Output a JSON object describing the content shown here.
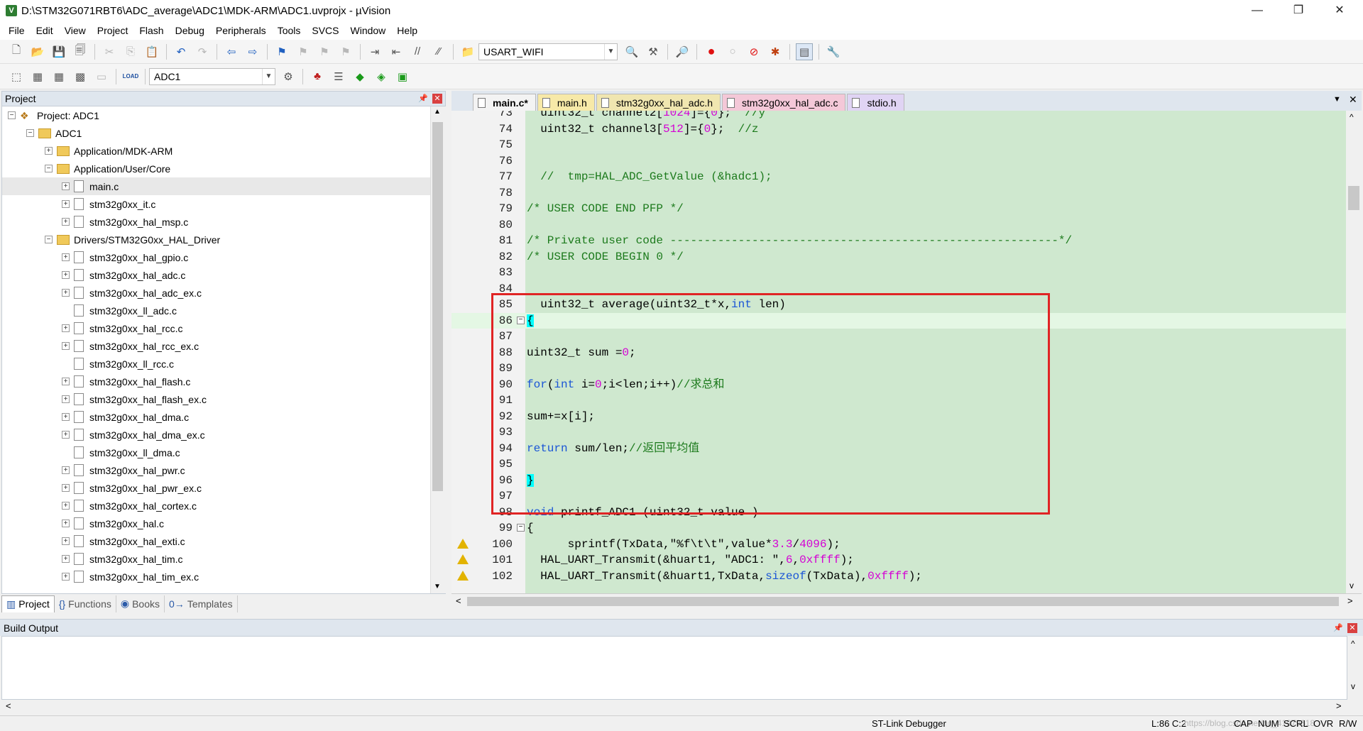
{
  "window": {
    "title": "D:\\STM32G071RBT6\\ADC_average\\ADC1\\MDK-ARM\\ADC1.uvprojx - µVision",
    "minimize": "—",
    "restore": "❐",
    "close": "✕"
  },
  "menu": [
    "File",
    "Edit",
    "View",
    "Project",
    "Flash",
    "Debug",
    "Peripherals",
    "Tools",
    "SVCS",
    "Window",
    "Help"
  ],
  "toolbar": {
    "target_combo": "USART_WIFI",
    "project_combo": "ADC1",
    "load_label": "LOAD"
  },
  "project_panel": {
    "title": "Project",
    "root": "Project: ADC1",
    "target": "ADC1",
    "groups": [
      {
        "name": "Application/MDK-ARM",
        "expanded": false,
        "files": []
      },
      {
        "name": "Application/User/Core",
        "expanded": true,
        "files": [
          "main.c",
          "stm32g0xx_it.c",
          "stm32g0xx_hal_msp.c"
        ]
      },
      {
        "name": "Drivers/STM32G0xx_HAL_Driver",
        "expanded": true,
        "files": [
          "stm32g0xx_hal_gpio.c",
          "stm32g0xx_hal_adc.c",
          "stm32g0xx_hal_adc_ex.c",
          "stm32g0xx_ll_adc.c",
          "stm32g0xx_hal_rcc.c",
          "stm32g0xx_hal_rcc_ex.c",
          "stm32g0xx_ll_rcc.c",
          "stm32g0xx_hal_flash.c",
          "stm32g0xx_hal_flash_ex.c",
          "stm32g0xx_hal_dma.c",
          "stm32g0xx_hal_dma_ex.c",
          "stm32g0xx_ll_dma.c",
          "stm32g0xx_hal_pwr.c",
          "stm32g0xx_hal_pwr_ex.c",
          "stm32g0xx_hal_cortex.c",
          "stm32g0xx_hal.c",
          "stm32g0xx_hal_exti.c",
          "stm32g0xx_hal_tim.c",
          "stm32g0xx_hal_tim_ex.c"
        ]
      }
    ],
    "selected_file": "main.c",
    "bottom_tabs": [
      "Project",
      "Functions",
      "Books",
      "Templates"
    ]
  },
  "editor": {
    "tabs": [
      {
        "label": "main.c*",
        "color": "#f7e9a8",
        "active": true
      },
      {
        "label": "main.h",
        "color": "#f7e9a8",
        "active": false
      },
      {
        "label": "stm32g0xx_hal_adc.h",
        "color": "#f0e6b0",
        "active": false
      },
      {
        "label": "stm32g0xx_hal_adc.c",
        "color": "#f4c8d8",
        "active": false
      },
      {
        "label": "stdio.h",
        "color": "#e0d4f4",
        "active": false
      }
    ],
    "lines": [
      {
        "n": "73",
        "text": "  uint32_t channel2[1024]={0};  //y"
      },
      {
        "n": "74",
        "text": "  uint32_t channel3[512]={0};  //z"
      },
      {
        "n": "75",
        "text": ""
      },
      {
        "n": "76",
        "text": ""
      },
      {
        "n": "77",
        "text": "  //  tmp=HAL_ADC_GetValue (&hadc1);"
      },
      {
        "n": "78",
        "text": ""
      },
      {
        "n": "79",
        "text": "/* USER CODE END PFP */"
      },
      {
        "n": "80",
        "text": ""
      },
      {
        "n": "81",
        "text": "/* Private user code ---------------------------------------------------------*/"
      },
      {
        "n": "82",
        "text": "/* USER CODE BEGIN 0 */"
      },
      {
        "n": "83",
        "text": ""
      },
      {
        "n": "84",
        "text": ""
      },
      {
        "n": "85",
        "text": "  uint32_t average(uint32_t*x,int len)"
      },
      {
        "n": "86",
        "text": "{"
      },
      {
        "n": "87",
        "text": ""
      },
      {
        "n": "88",
        "text": "uint32_t sum =0;"
      },
      {
        "n": "89",
        "text": ""
      },
      {
        "n": "90",
        "text": "for(int i=0;i<len;i++)//求总和"
      },
      {
        "n": "91",
        "text": ""
      },
      {
        "n": "92",
        "text": "sum+=x[i];"
      },
      {
        "n": "93",
        "text": ""
      },
      {
        "n": "94",
        "text": "return sum/len;//返回平均值"
      },
      {
        "n": "95",
        "text": ""
      },
      {
        "n": "96",
        "text": "}"
      },
      {
        "n": "97",
        "text": ""
      },
      {
        "n": "98",
        "text": "void printf_ADC1 (uint32_t value )"
      },
      {
        "n": "99",
        "text": "{"
      },
      {
        "n": "100",
        "text": "      sprintf(TxData,\"%f\\t\\t\",value*3.3/4096);"
      },
      {
        "n": "101",
        "text": "  HAL_UART_Transmit(&huart1, \"ADC1: \",6,0xffff);"
      },
      {
        "n": "102",
        "text": "  HAL_UART_Transmit(&huart1,TxData,sizeof(TxData),0xffff);"
      }
    ]
  },
  "build_output": {
    "title": "Build Output"
  },
  "status": {
    "debugger": "ST-Link Debugger",
    "position": "L:86 C:2",
    "caps": "CAP",
    "num": "NUM",
    "scrl": "SCRL",
    "ovr": "OVR",
    "rw": "R/W",
    "watermark": "https://blog.csdn.net/qq_41979618"
  }
}
